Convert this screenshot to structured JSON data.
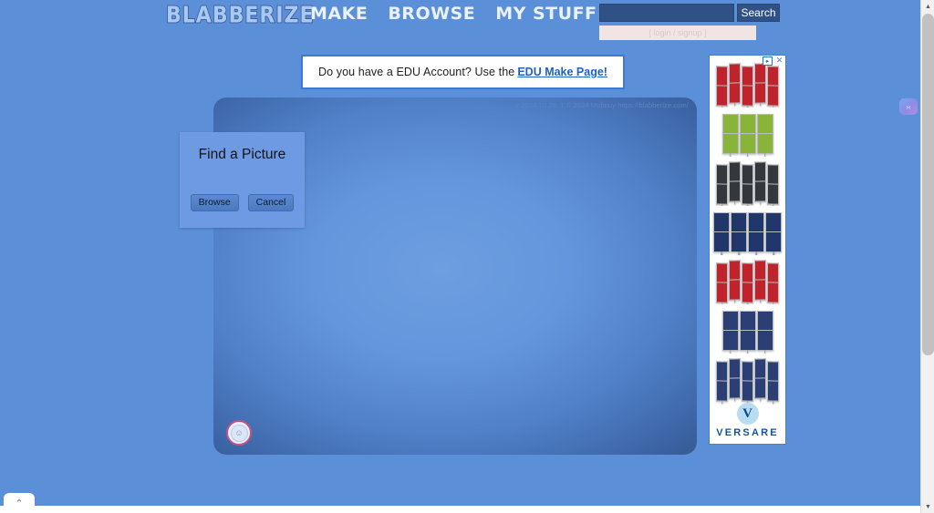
{
  "site": {
    "logo": "BLABBERIZE",
    "nav": [
      {
        "label": "MAKE"
      },
      {
        "label": "BROWSE"
      },
      {
        "label": "MY STUFF"
      }
    ],
    "search": {
      "value": "",
      "placeholder": "",
      "button_label": "Search"
    },
    "account": {
      "login_signup": "[ login / signup ]"
    }
  },
  "edu_banner": {
    "text": "Do you have a EDU Account? Use the",
    "link_label": "EDU Make Page!"
  },
  "stage": {
    "version_text": "v 2024.10.20. 1  © 2024 Mobouy https://blabberize.com/",
    "record_icon": "camera-icon"
  },
  "dialog": {
    "title": "Find a Picture",
    "buttons": [
      {
        "label": "Browse"
      },
      {
        "label": "Cancel"
      }
    ]
  },
  "ad": {
    "adchoices_icon": "adchoices-icon",
    "close_icon": "close-icon",
    "brand_mark": "V",
    "brand_name": "VERSARE",
    "panels": [
      {
        "color": "#c0232b",
        "leaves": 5,
        "style": "tilt"
      },
      {
        "color": "#8ab33a",
        "leaves": 3,
        "style": "wide"
      },
      {
        "color": "#34383c",
        "leaves": 5,
        "style": "tilt"
      },
      {
        "color": "#21366b",
        "leaves": 4,
        "style": "wide"
      },
      {
        "color": "#c0232b",
        "leaves": 5,
        "style": "tilt"
      },
      {
        "color": "#2b3f74",
        "leaves": 3,
        "style": "wide"
      },
      {
        "color": "#2b3f74",
        "leaves": 5,
        "style": "tilt"
      }
    ]
  },
  "widget": {
    "icon": "chat-widget-icon",
    "glyph": "›‹"
  },
  "bottom_tab": {
    "icon": "chevron-up-icon",
    "glyph": "⌃"
  },
  "scrollbar": {
    "up_glyph": "▲",
    "down_glyph": "▼"
  },
  "colors": {
    "page_background": "#5b8fd8",
    "stage_center": "#6d9ee0",
    "stage_edge": "#35598f",
    "search_field": "#2f5185",
    "login_bar": "#f2e4e2",
    "edu_link": "#1b62c6",
    "record_ring": "#c4547e",
    "ad_brand": "#13539b"
  }
}
